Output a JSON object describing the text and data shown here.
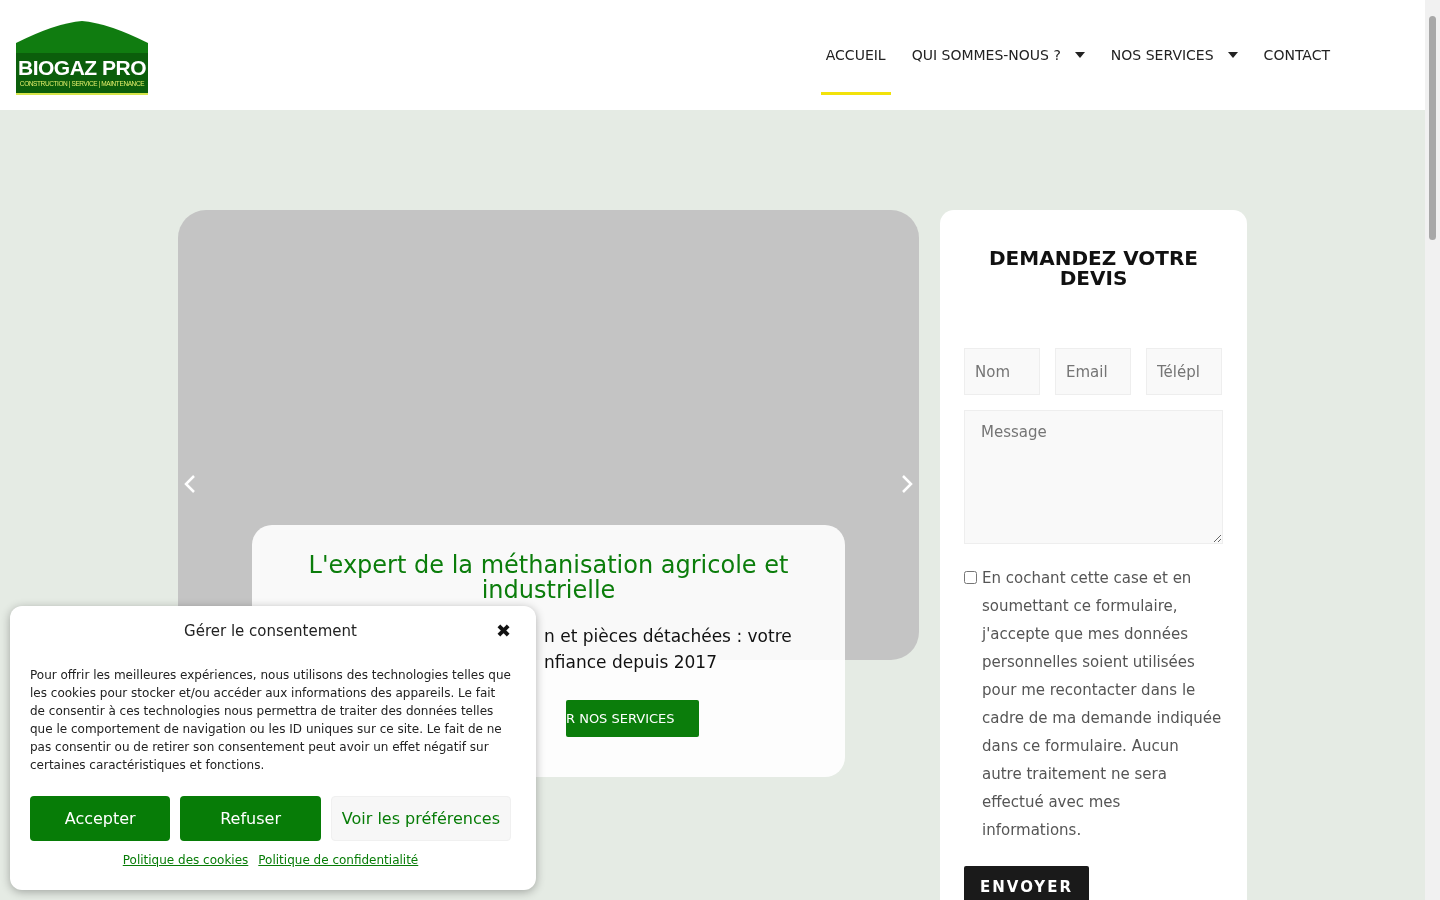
{
  "logo": {
    "title": "BIOGAZ PRO",
    "tagline": "CONSTRUCTION | SERVICE | MAINTENANCE"
  },
  "nav": [
    {
      "label": "ACCUEIL",
      "selected": true,
      "dropdown": false
    },
    {
      "label": "QUI SOMMES-NOUS ?",
      "selected": false,
      "dropdown": true
    },
    {
      "label": "NOS SERVICES",
      "selected": false,
      "dropdown": true
    },
    {
      "label": "CONTACT",
      "selected": false,
      "dropdown": false
    }
  ],
  "hero": {
    "title": "L'expert de la méthanisation agricole et industrielle",
    "subtitle_lines": [
      "n et pièces détachées : votre",
      "nfiance depuis 2017"
    ],
    "button": "R NOS SERVICES"
  },
  "quote_form": {
    "title": "DEMANDEZ VOTRE DEVIS",
    "fields": [
      {
        "placeholder": "Nom"
      },
      {
        "placeholder": "Email"
      },
      {
        "placeholder": "Télépl"
      }
    ],
    "message_placeholder": "Message",
    "consent": {
      "checked": false,
      "text": "En cochant cette case et en soumettant ce formulaire, j'accepte que mes données personnelles soient utilisées pour me recontacter dans le cadre de ma demande indiquée dans ce formulaire. Aucun autre traitement ne sera effectué avec mes informations."
    },
    "submit": "ENVOYER"
  },
  "cookie_dialog": {
    "title": "Gérer le consentement",
    "close": "✖",
    "text": "Pour offrir les meilleures expériences, nous utilisons des technologies telles que les cookies pour stocker et/ou accéder aux informations des appareils. Le fait de consentir à ces technologies nous permettra de traiter des données telles que le comportement de navigation ou les ID uniques sur ce site. Le fait de ne pas consentir ou de retirer son consentement peut avoir un effet négatif sur certaines caractéristiques et fonctions.",
    "buttons": [
      {
        "label": "Accepter",
        "kind": "primary"
      },
      {
        "label": "Refuser",
        "kind": "primary"
      },
      {
        "label": "Voir les préférences",
        "kind": "secondary"
      }
    ],
    "links": [
      "Politique des cookies",
      "Politique de confidentialité"
    ]
  }
}
